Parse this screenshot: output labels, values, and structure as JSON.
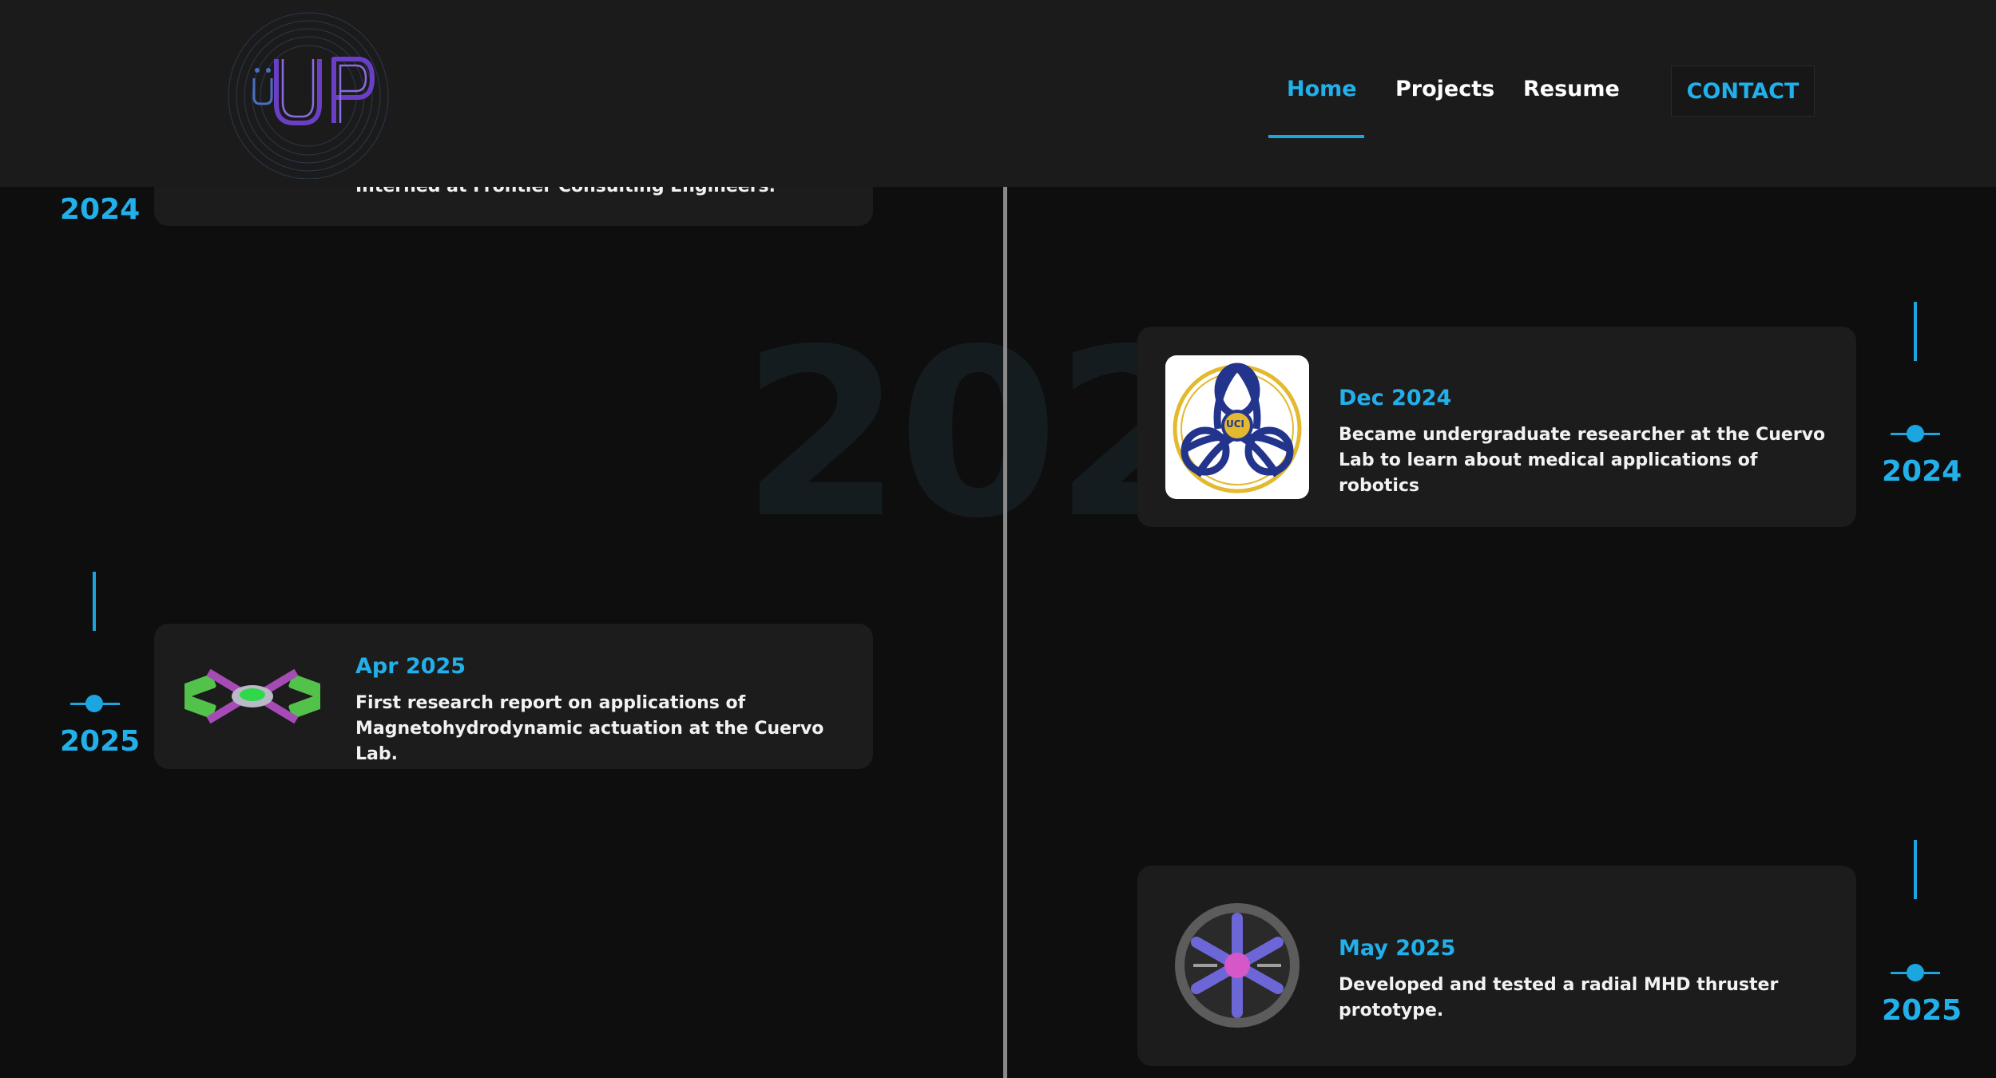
{
  "nav": {
    "items": [
      {
        "label": "Home",
        "active": true
      },
      {
        "label": "Projects",
        "active": false
      },
      {
        "label": "Resume",
        "active": false
      }
    ],
    "contact_label": "CONTACT",
    "accent_color": "#22b0ea"
  },
  "logo": {
    "text": "JP",
    "icon": "jp-monogram-logo"
  },
  "background_year": "202",
  "timeline": {
    "left": [
      {
        "year": "2024",
        "description": "Interned at Frontier Consulting Engineers."
      },
      {
        "year": "2025",
        "date": "Apr 2025",
        "description": "First research report on applications of Magnetohydrodynamic actuation at the Cuervo Lab.",
        "icon": "mhd-actuator-render-icon"
      }
    ],
    "right": [
      {
        "year": "2024",
        "date": "Dec 2024",
        "description": "Became undergraduate researcher at the Cuervo Lab to learn about medical applications of robotics",
        "icon": "cuervo-lab-logo-icon",
        "badge": "UCI"
      },
      {
        "year": "2025",
        "date": "May 2025",
        "description": "Developed and tested a radial MHD thruster prototype.",
        "icon": "radial-thruster-icon"
      }
    ]
  }
}
